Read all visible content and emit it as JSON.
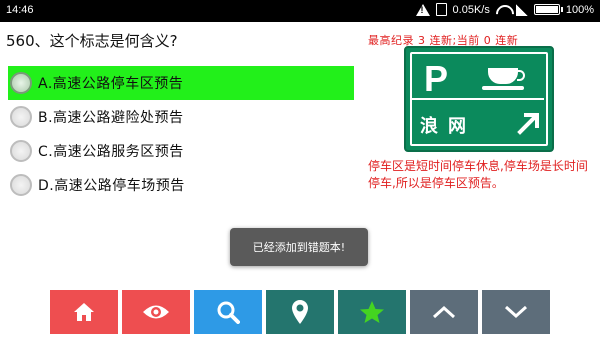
{
  "status_bar": {
    "time": "14:46",
    "network_speed": "0.05K/s",
    "battery": "100%"
  },
  "question": {
    "text": "560、这个标志是何含义?",
    "options": [
      {
        "label": "A.高速公路停车区预告",
        "selected": true
      },
      {
        "label": "B.高速公路避险处预告",
        "selected": false
      },
      {
        "label": "C.高速公路服务区预告",
        "selected": false
      },
      {
        "label": "D.高速公路停车场预告",
        "selected": false
      }
    ]
  },
  "record": "最高纪录 3 连新;当前 0 连新",
  "sign": {
    "symbol": "P",
    "place": "浪网"
  },
  "explanation": "停车区是短时间停车休息,停车场是长时间停车,所以是停车区预告。",
  "toast": "已经添加到错题本!",
  "toolbar": [
    {
      "name": "home-button",
      "icon": "home-icon",
      "color": "#ee4e50"
    },
    {
      "name": "view-answer-button",
      "icon": "eye-icon",
      "color": "#ee4e50"
    },
    {
      "name": "search-button",
      "icon": "search-icon",
      "color": "#2e9ae6"
    },
    {
      "name": "location-button",
      "icon": "map-pin-icon",
      "color": "#24756e"
    },
    {
      "name": "favorite-button",
      "icon": "star-icon",
      "color": "#24756e"
    },
    {
      "name": "previous-button",
      "icon": "chevron-up-icon",
      "color": "#5d6d7a"
    },
    {
      "name": "next-button",
      "icon": "chevron-down-icon",
      "color": "#5d6d7a"
    }
  ],
  "colors": {
    "selected_option": "#22f01a",
    "record_text": "#e02020",
    "sign_green": "#0b8a5c"
  }
}
